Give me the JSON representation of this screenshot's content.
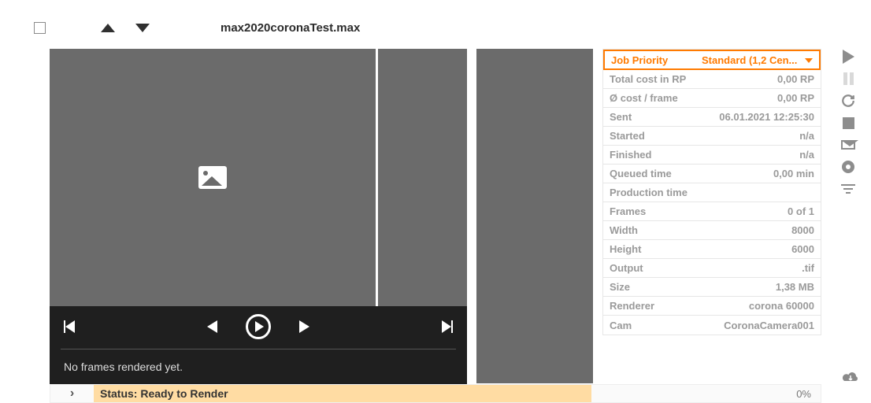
{
  "header": {
    "filename": "max2020coronaTest.max"
  },
  "player": {
    "status": "No frames rendered yet."
  },
  "properties": {
    "priority": {
      "label": "Job Priority",
      "value": "Standard (1,2 Cen..."
    },
    "rows": [
      {
        "label": "Total cost in RP",
        "value": "0,00 RP"
      },
      {
        "label": "Ø cost / frame",
        "value": "0,00 RP"
      },
      {
        "label": "Sent",
        "value": "06.01.2021 12:25:30"
      },
      {
        "label": "Started",
        "value": "n/a"
      },
      {
        "label": "Finished",
        "value": "n/a"
      },
      {
        "label": "Queued time",
        "value": "0,00 min"
      },
      {
        "label": "Production time",
        "value": ""
      },
      {
        "label": "Frames",
        "value": "0 of 1"
      },
      {
        "label": "Width",
        "value": "8000"
      },
      {
        "label": "Height",
        "value": "6000"
      },
      {
        "label": "Output",
        "value": ".tif"
      },
      {
        "label": "Size",
        "value": "1,38 MB"
      },
      {
        "label": "Renderer",
        "value": "corona 60000"
      },
      {
        "label": "Cam",
        "value": "CoronaCamera001"
      }
    ]
  },
  "status": {
    "text": "Status: Ready to Render",
    "percent": "0%"
  }
}
